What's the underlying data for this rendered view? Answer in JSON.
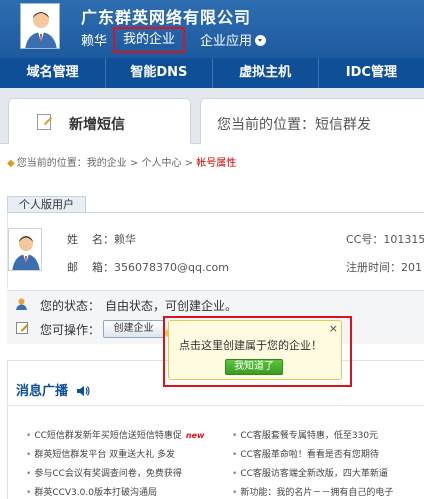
{
  "header": {
    "company_name": "广东群英网络有限公司",
    "user_name": "赖华",
    "nav_my_enterprise": "我的企业",
    "nav_enterprise_apps": "企业应用"
  },
  "main_nav": {
    "items": [
      {
        "label": "域名管理"
      },
      {
        "label": "智能DNS"
      },
      {
        "label": "虚拟主机"
      },
      {
        "label": "IDC管理"
      }
    ]
  },
  "tab": {
    "label": "新增短信",
    "location_text": "您当前的位置：短信群发"
  },
  "breadcrumb": {
    "prefix": "您当前的位置：",
    "item1": "我的企业",
    "sep": " > ",
    "item2": "个人中心",
    "current": "帐号属性"
  },
  "section": {
    "tab_label": "个人版用户"
  },
  "profile": {
    "name_label": "姓    名：",
    "name_value": "赖华",
    "email_label": "邮    箱：",
    "email_value": "356078370@qq.com",
    "cc_label": "CC号：",
    "cc_value": "101315",
    "reg_label": "注册时间：",
    "reg_value": "201"
  },
  "status": {
    "status_label": "您的状态：",
    "status_value": "自由状态，可创建企业。",
    "ops_label": "您可操作：",
    "create_button": "创建企业"
  },
  "popup": {
    "message": "点击这里创建属于您的企业！",
    "close": "×",
    "ok_button": "我知道了"
  },
  "news": {
    "title": "消息广播",
    "left": [
      {
        "text": "CC短信群发新年买短信送短信特惠促",
        "badge": "new"
      },
      {
        "text": "群英短信群发平台 双重送大礼 多发",
        "badge": ""
      },
      {
        "text": "参与CC会议有奖调查问卷，免费获得",
        "badge": ""
      },
      {
        "text": "群英CCV3.0.0版本打破沟通局",
        "badge": ""
      }
    ],
    "right": [
      {
        "text": "CC客服套餐专属特惠，低至330元"
      },
      {
        "text": "CC客服革命啦！看看是否有您期待"
      },
      {
        "text": "CC客服访客端全新改版，四大革新逼"
      },
      {
        "text": "新功能：我的名片－－拥有自己的电子"
      }
    ]
  },
  "colors": {
    "header_blue": "#1d5aa0",
    "nav_blue": "#0f4f97",
    "highlight_red": "#d8141c",
    "ok_green": "#3a9a23",
    "crumb_current": "#cc0000"
  }
}
